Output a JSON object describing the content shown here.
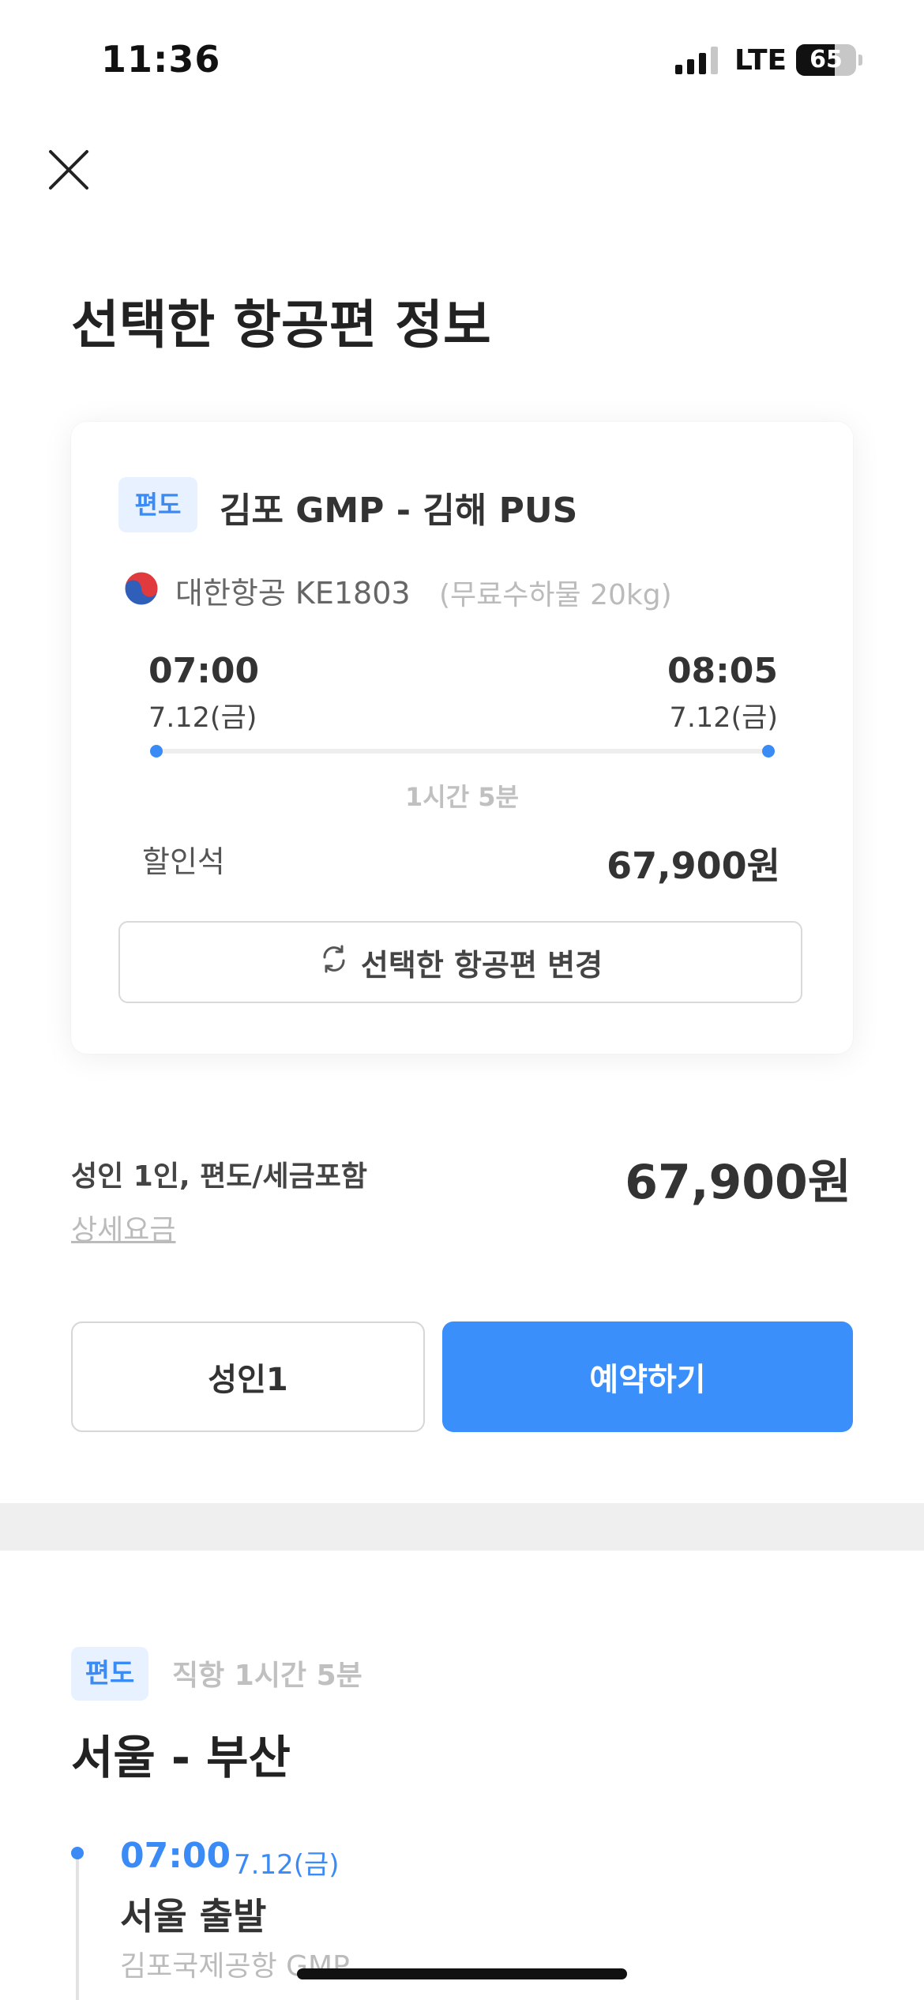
{
  "status_bar": {
    "time": "11:36",
    "network": "LTE",
    "battery": "65",
    "battery_level": 0.65
  },
  "page": {
    "title": "선택한 항공편 정보"
  },
  "flight_card": {
    "badge": "편도",
    "route": "김포 GMP - 김해 PUS",
    "airline": "대한항공 KE1803",
    "baggage": "(무료수하물 20kg)",
    "departure": {
      "time": "07:00",
      "date": "7.12(금)"
    },
    "arrival": {
      "time": "08:05",
      "date": "7.12(금)"
    },
    "duration": "1시간 5분",
    "seat_class": "할인석",
    "price": "67,900원",
    "change_button": "선택한 항공편 변경"
  },
  "summary": {
    "label": "성인 1인, 편도/세금포함",
    "detail_link": "상세요금",
    "total": "67,900원"
  },
  "actions": {
    "passengers_button": "성인1",
    "book_button": "예약하기"
  },
  "itinerary": {
    "badge": "편도",
    "info": "직항 1시간 5분",
    "title": "서울 - 부산",
    "departure": {
      "time": "07:00",
      "date": "7.12(금)",
      "city": "서울 출발",
      "airport": "김포국제공항 GMP"
    }
  },
  "colors": {
    "accent": "#3a8ffb",
    "badge_bg": "#e7f1ff"
  }
}
